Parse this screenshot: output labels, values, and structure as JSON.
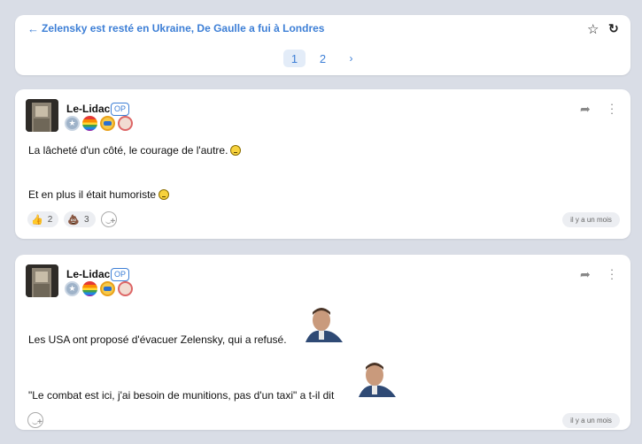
{
  "topic": {
    "back_arrow": "←",
    "title": "Zelensky est resté en Ukraine, De Gaulle a fui à Londres",
    "star": "☆",
    "reload": "↻",
    "pages": [
      "1",
      "2"
    ],
    "next": "›"
  },
  "posts": [
    {
      "author": "Le-Lidac",
      "op_label": "OP",
      "lines": [
        "La lâcheté d'un côté, le courage de l'autre.",
        "Et en plus il était humoriste"
      ],
      "reactions": [
        {
          "icon": "thumbs-up-icon",
          "glyph": "👍",
          "count": "2"
        },
        {
          "icon": "poop-icon",
          "glyph": "💩",
          "count": "3"
        }
      ],
      "time": "il y a un mois"
    },
    {
      "author": "Le-Lidac",
      "op_label": "OP",
      "lines": [
        "Les USA ont proposé d'évacuer Zelensky, qui a refusé.",
        "\"Le combat est ici, j'ai besoin de munitions, pas d'un taxi\" a t-il dit"
      ],
      "time": "il y a un mois"
    }
  ],
  "colors": {
    "accent": "#3d7fd6",
    "background": "#d9dde6"
  }
}
